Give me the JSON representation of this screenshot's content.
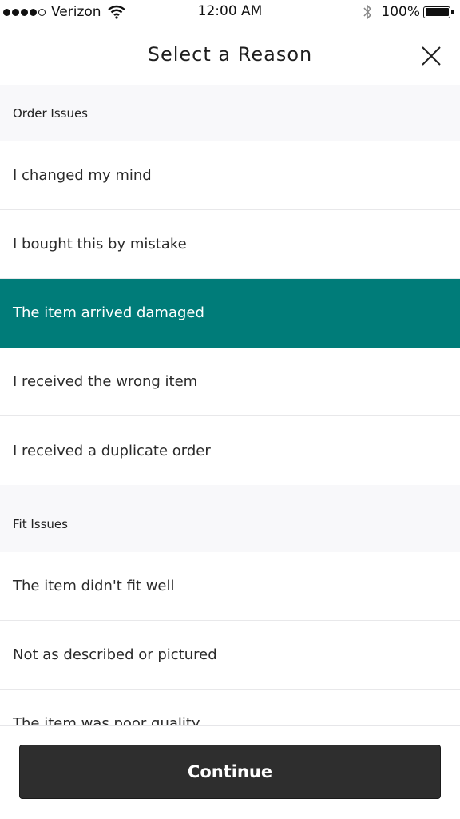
{
  "status_bar": {
    "carrier": "Verizon",
    "time": "12:00 AM",
    "battery": "100%",
    "signal_bars": 4
  },
  "header": {
    "title": "Select a Reason",
    "close_icon": "close-icon"
  },
  "sections": [
    {
      "title": "Order Issues",
      "items": [
        "I changed my mind",
        "I bought this by mistake",
        "The item arrived damaged",
        "I received the wrong item",
        "I received a duplicate order"
      ]
    },
    {
      "title": "Fit Issues",
      "items": [
        "The item didn't fit well",
        "Not as described or pictured",
        "The item was poor quality"
      ]
    }
  ],
  "selected_item": "The item arrived damaged",
  "footer": {
    "continue_label": "Continue"
  },
  "colors": {
    "selected_background": "#007c79",
    "button_background": "#2e2e2e",
    "section_background": "#f8f8fa"
  }
}
